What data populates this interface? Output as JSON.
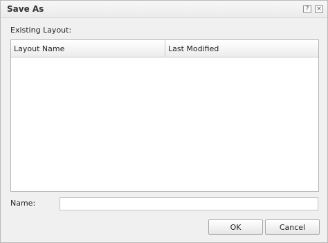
{
  "dialog": {
    "title": "Save As",
    "help_glyph": "?",
    "close_glyph": "×",
    "icons": [
      "help-icon",
      "close-icon"
    ]
  },
  "existing": {
    "label": "Existing Layout:",
    "columns": [
      "Layout Name",
      "Last Modified"
    ],
    "rows": []
  },
  "name_field": {
    "label": "Name:",
    "value": "",
    "placeholder": ""
  },
  "buttons": {
    "ok": "OK",
    "cancel": "Cancel"
  }
}
